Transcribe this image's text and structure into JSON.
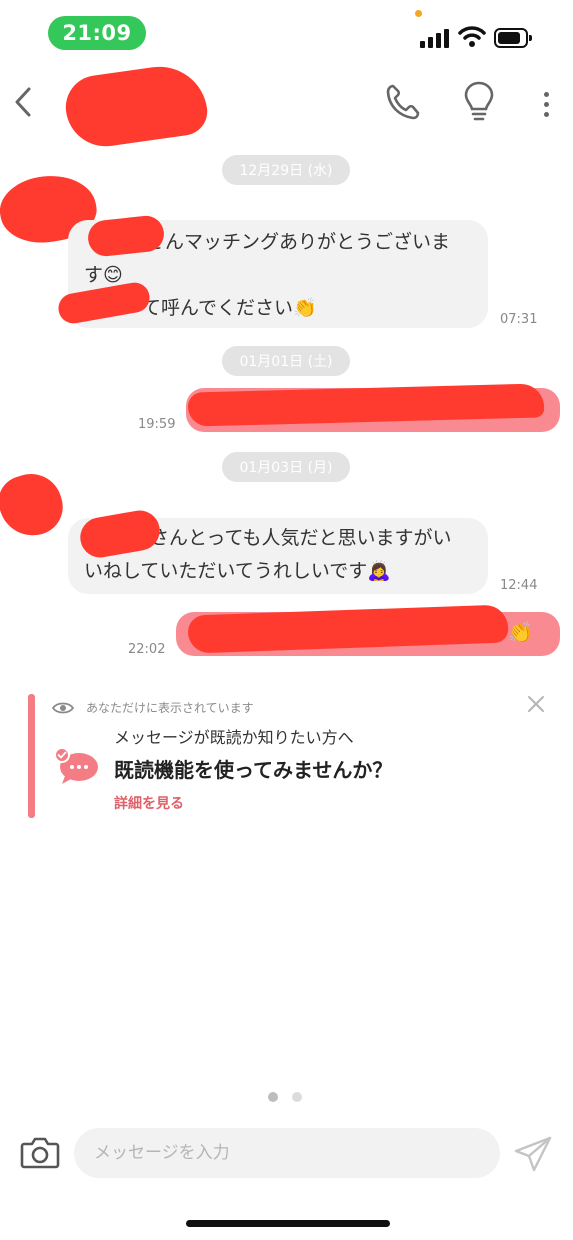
{
  "status_bar": {
    "time": "21:09"
  },
  "chat": {
    "dates": [
      "12月29日 (水)",
      "01月01日 (土)",
      "01月03日 (月)"
    ],
    "messages": [
      {
        "direction": "incoming",
        "lines": [
          "さんマッチングありがとうございま",
          "す😊",
          "て呼んでください👏"
        ],
        "time": "07:31"
      },
      {
        "direction": "outgoing",
        "text": "",
        "time": "19:59"
      },
      {
        "direction": "incoming",
        "lines": [
          "さんとっても人気だと思いますがい",
          "いねしていただいてうれしいです🙇‍♀️"
        ],
        "time": "12:44"
      },
      {
        "direction": "outgoing",
        "text": "👏",
        "time": "22:02"
      }
    ]
  },
  "notice": {
    "label": "あなただけに表示されています",
    "line1": "メッセージが既読か知りたい方へ",
    "line2": "既読機能を使ってみませんか？",
    "link": "詳細を見る"
  },
  "composer": {
    "placeholder": "メッセージを入力"
  },
  "pager": {
    "current": 1,
    "total": 2
  },
  "colors": {
    "accent": "#f98a91",
    "status_green": "#34c759",
    "redaction": "#ff3b30"
  },
  "icons": [
    "back-icon",
    "phone-icon",
    "lightbulb-icon",
    "more-icon",
    "eye-icon",
    "close-icon",
    "chat-bubble-icon",
    "camera-icon",
    "send-icon"
  ]
}
